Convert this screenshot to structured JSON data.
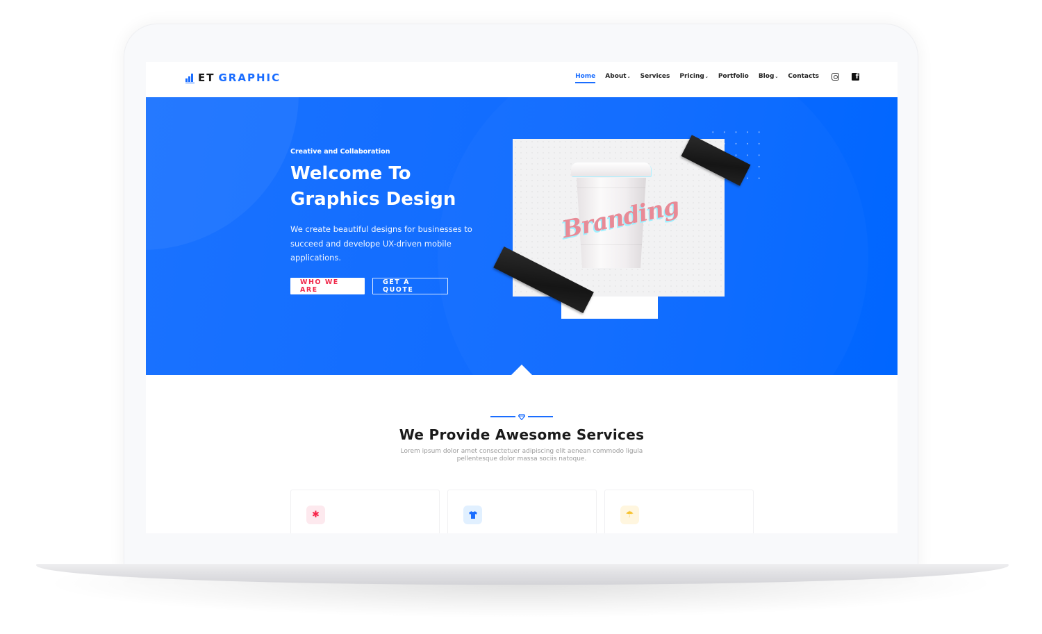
{
  "brand": {
    "name_part1": "ET",
    "name_part2": "GRAPHIC",
    "icon": "bar-chart-up-icon"
  },
  "nav": {
    "items": [
      {
        "label": "Home",
        "active": true,
        "has_dropdown": false
      },
      {
        "label": "About",
        "active": false,
        "has_dropdown": true
      },
      {
        "label": "Services",
        "active": false,
        "has_dropdown": false
      },
      {
        "label": "Pricing",
        "active": false,
        "has_dropdown": true
      },
      {
        "label": "Portfolio",
        "active": false,
        "has_dropdown": false
      },
      {
        "label": "Blog",
        "active": false,
        "has_dropdown": true
      },
      {
        "label": "Contacts",
        "active": false,
        "has_dropdown": false
      }
    ],
    "dropdown_glyph": "⌄",
    "social": [
      "instagram-icon",
      "facebook-icon"
    ],
    "facebook_glyph": "f"
  },
  "hero": {
    "subtitle": "Creative and Collaboration",
    "title_line1": "Welcome To",
    "title_line2": "Graphics Design",
    "description": "We create beautiful designs for businesses to succeed and develope UX-driven mobile applications.",
    "primary_button": "WHO WE ARE",
    "secondary_button": "GET A QUOTE",
    "image_text": "Branding"
  },
  "services": {
    "title": "We Provide Awesome Services",
    "description": "Lorem ipsum dolor amet consectetuer adipiscing elit aenean commodo ligula pellentesque dolor massa sociis natoque.",
    "cards": [
      {
        "icon": "asterisk-icon",
        "glyph": "✱"
      },
      {
        "icon": "tshirt-icon",
        "glyph": "👕"
      },
      {
        "icon": "umbrella-icon",
        "glyph": "☂"
      }
    ]
  },
  "colors": {
    "primary": "#1a6dff",
    "accent": "#f0284a",
    "yellow": "#f7c332",
    "text_dark": "#1a1a1a"
  }
}
